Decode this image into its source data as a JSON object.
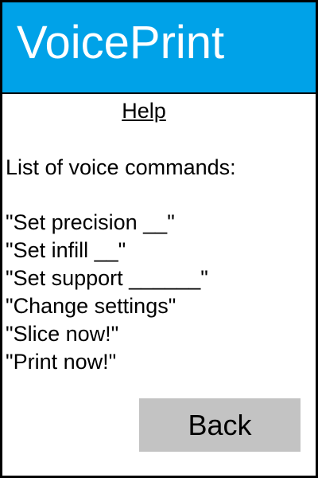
{
  "app": {
    "title": "VoicePrint"
  },
  "help": {
    "title": "Help",
    "intro": "List of voice commands:",
    "commands": [
      "\"Set precision __\"",
      "\"Set infill __\"",
      "\"Set support ______\"",
      "\"Change settings\"",
      "\"Slice now!\"",
      "\"Print now!\""
    ]
  },
  "actions": {
    "back_label": "Back"
  },
  "colors": {
    "header_background": "#00a2e8",
    "header_text": "#ffffff",
    "button_background": "#c3c3c3",
    "frame_border": "#000000"
  }
}
